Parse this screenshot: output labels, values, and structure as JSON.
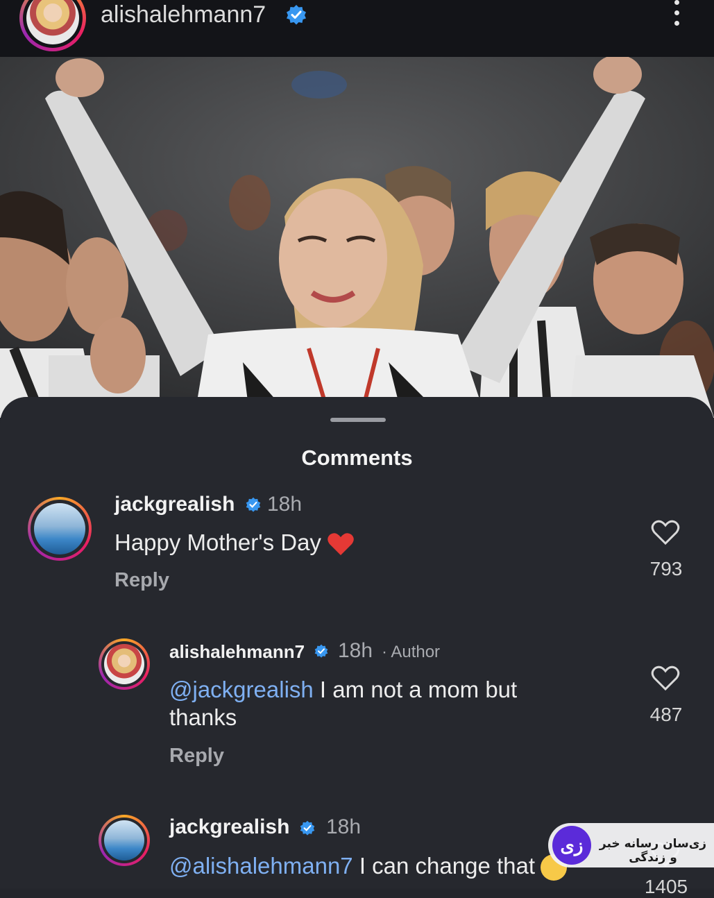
{
  "header": {
    "username": "alishalehmann7",
    "verified": true,
    "more_icon": "more-vertical-icon"
  },
  "sheet": {
    "title": "Comments"
  },
  "comments": [
    {
      "username": "jackgrealish",
      "time": "18h",
      "text": "Happy Mother's Day",
      "emoji": "red-heart-emoji",
      "reply": "Reply",
      "likes": "793"
    },
    {
      "username": "alishalehmann7",
      "time": "18h",
      "author_label": "· Author",
      "mention": "@jackgrealish",
      "text_line1": " I am not a mom but",
      "text_line2": "thanks",
      "reply": "Reply",
      "likes": "487"
    },
    {
      "username": "jackgrealish",
      "time": "18h",
      "mention": "@alishalehmann7",
      "text": " I can change that",
      "emoji": "smiling-face-emoji",
      "likes": "1405"
    }
  ],
  "watermark": {
    "logo": "زی",
    "text": "زی‌سان رسانه خبر و زندگی"
  },
  "colors": {
    "background": "#26282e",
    "mention": "#7fb0f2",
    "verified": "#3897f0"
  }
}
